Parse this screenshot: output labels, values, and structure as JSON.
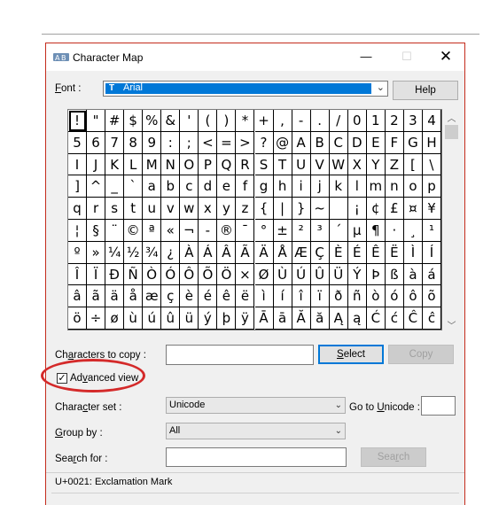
{
  "window": {
    "title": "Character Map",
    "minimize_glyph": "—",
    "maximize_glyph": "☐",
    "close_glyph": "✕"
  },
  "font": {
    "label_access": "F",
    "label_rest": "ont :",
    "value": "Arial",
    "icon_glyph": "T"
  },
  "help_button": "Help",
  "characters": [
    "!",
    "\"",
    "#",
    "$",
    "%",
    "&",
    "'",
    "(",
    ")",
    "*",
    "+",
    ",",
    "-",
    ".",
    "/",
    "0",
    "1",
    "2",
    "3",
    "4",
    "5",
    "6",
    "7",
    "8",
    "9",
    ":",
    ";",
    "<",
    "=",
    ">",
    "?",
    "@",
    "A",
    "B",
    "C",
    "D",
    "E",
    "F",
    "G",
    "H",
    "I",
    "J",
    "K",
    "L",
    "M",
    "N",
    "O",
    "P",
    "Q",
    "R",
    "S",
    "T",
    "U",
    "V",
    "W",
    "X",
    "Y",
    "Z",
    "[",
    "\\",
    "]",
    "^",
    "_",
    "`",
    "a",
    "b",
    "c",
    "d",
    "e",
    "f",
    "g",
    "h",
    "i",
    "j",
    "k",
    "l",
    "m",
    "n",
    "o",
    "p",
    "q",
    "r",
    "s",
    "t",
    "u",
    "v",
    "w",
    "x",
    "y",
    "z",
    "{",
    "|",
    "}",
    "~",
    " ",
    "¡",
    "¢",
    "£",
    "¤",
    "¥",
    "¦",
    "§",
    "¨",
    "©",
    "ª",
    "«",
    "¬",
    "-",
    "®",
    "¯",
    "°",
    "±",
    "²",
    "³",
    "´",
    "µ",
    "¶",
    "·",
    "¸",
    "¹",
    "º",
    "»",
    "¼",
    "½",
    "¾",
    "¿",
    "À",
    "Á",
    "Â",
    "Ã",
    "Ä",
    "Å",
    "Æ",
    "Ç",
    "È",
    "É",
    "Ê",
    "Ë",
    "Ì",
    "Í",
    "Î",
    "Ï",
    "Ð",
    "Ñ",
    "Ò",
    "Ó",
    "Ô",
    "Õ",
    "Ö",
    "×",
    "Ø",
    "Ù",
    "Ú",
    "Û",
    "Ü",
    "Ý",
    "Þ",
    "ß",
    "à",
    "á",
    "â",
    "ã",
    "ä",
    "å",
    "æ",
    "ç",
    "è",
    "é",
    "ê",
    "ë",
    "ì",
    "í",
    "î",
    "ï",
    "ð",
    "ñ",
    "ò",
    "ó",
    "ô",
    "õ",
    "ö",
    "÷",
    "ø",
    "ù",
    "ú",
    "û",
    "ü",
    "ý",
    "þ",
    "ÿ",
    "Ā",
    "ā",
    "Ă",
    "ă",
    "Ą",
    "ą",
    "Ć",
    "ć",
    "Ĉ",
    "ĉ"
  ],
  "copy_row": {
    "label_pre": "Ch",
    "label_access": "a",
    "label_post": "racters to copy :",
    "value": "",
    "select_access": "S",
    "select_rest": "elect",
    "copy_label": "Copy"
  },
  "advanced_view": {
    "checked_glyph": "✓",
    "label_pre": "Ad",
    "label_access": "v",
    "label_post": "anced view",
    "checked": true
  },
  "character_set": {
    "label_pre": "Chara",
    "label_access": "c",
    "label_post": "ter set :",
    "value": "Unicode",
    "goto_pre": "Go to ",
    "goto_access": "U",
    "goto_post": "nicode :",
    "goto_value": ""
  },
  "group_by": {
    "label_access": "G",
    "label_rest": "roup by :",
    "value": "All"
  },
  "search": {
    "label_pre": "Sea",
    "label_access": "r",
    "label_post": "ch for :",
    "value": "",
    "button_pre": "Sea",
    "button_access": "r",
    "button_post": "ch"
  },
  "status": "U+0021: Exclamation Mark",
  "colors": {
    "selection_blue": "#0078d7",
    "annotation_red": "#d42a2a",
    "window_border": "#c42b1c"
  }
}
